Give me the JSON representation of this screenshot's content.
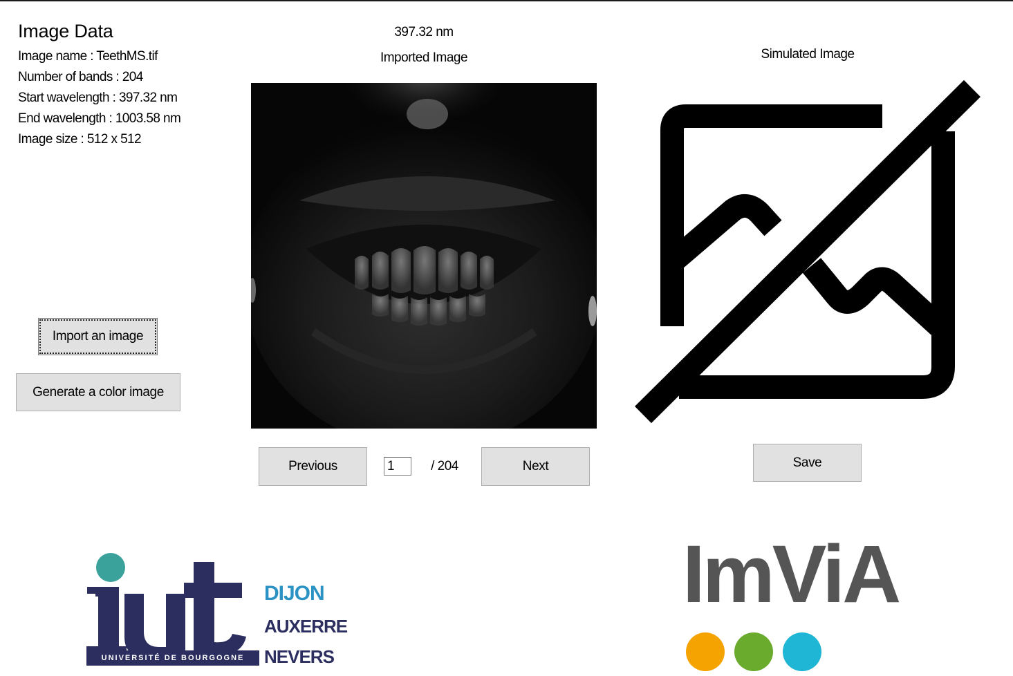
{
  "info": {
    "title": "Image Data",
    "image_name": "Image name : TeethMS.tif",
    "num_bands": "Number of bands : 204",
    "start_wavelength": "Start wavelength : 397.32 nm",
    "end_wavelength": "End wavelength : 1003.58 nm",
    "image_size": "Image size : 512 x 512"
  },
  "actions": {
    "import_label": "Import an image",
    "generate_label": "Generate a color image"
  },
  "viewer": {
    "wavelength": "397.32 nm",
    "imported_title": "Imported Image",
    "previous_label": "Previous",
    "band_value": "1",
    "band_total": "/ 204",
    "next_label": "Next"
  },
  "simulated": {
    "title": "Simulated Image",
    "placeholder_icon": "image-off-icon",
    "save_label": "Save"
  },
  "logos": {
    "iut_tagline": "UNIVERSITÉ DE BOURGOGNE",
    "iut_city_1": "DIJON",
    "iut_city_2": "AUXERRE",
    "iut_city_3": "NEVERS",
    "imvia_name": "ImViA"
  },
  "colors": {
    "iut_navy": "#2b2e5f",
    "iut_teal": "#3aa29a",
    "iut_blue": "#2a93c4",
    "imvia_gray": "#555555",
    "dot_orange": "#f5a300",
    "dot_green": "#6aab2d",
    "dot_cyan": "#1fb5d4"
  }
}
